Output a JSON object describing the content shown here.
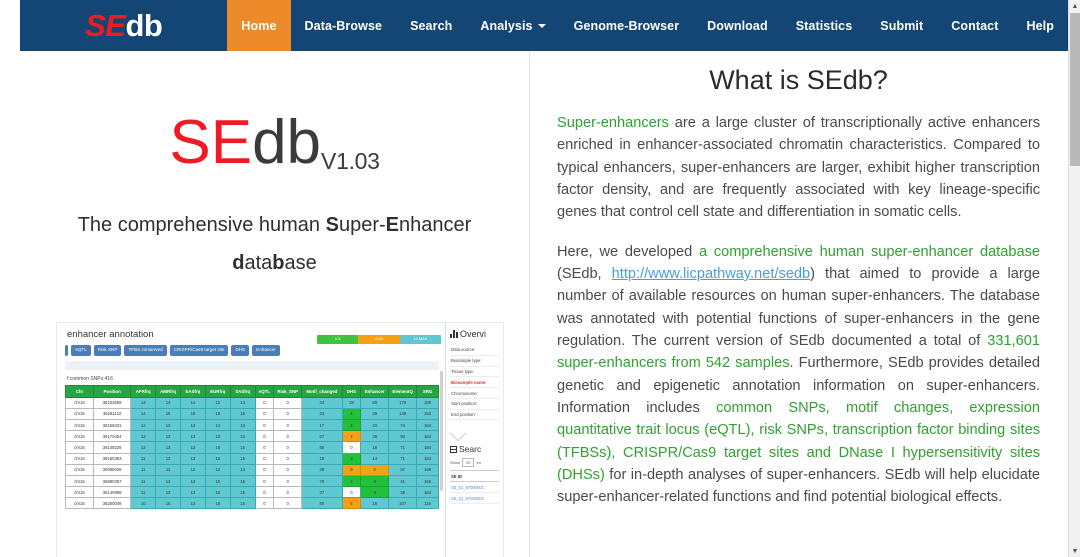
{
  "brand": {
    "part1": "SE",
    "part2": "db"
  },
  "nav": {
    "items": [
      {
        "label": "Home",
        "active": true,
        "caret": false
      },
      {
        "label": "Data-Browse",
        "active": false,
        "caret": false
      },
      {
        "label": "Search",
        "active": false,
        "caret": false
      },
      {
        "label": "Analysis",
        "active": false,
        "caret": true
      },
      {
        "label": "Genome-Browser",
        "active": false,
        "caret": false
      },
      {
        "label": "Download",
        "active": false,
        "caret": false
      },
      {
        "label": "Statistics",
        "active": false,
        "caret": false
      },
      {
        "label": "Submit",
        "active": false,
        "caret": false
      },
      {
        "label": "Contact",
        "active": false,
        "caret": false
      },
      {
        "label": "Help",
        "active": false,
        "caret": false
      }
    ],
    "active_color": "#ED8B2B",
    "background_color": "#134675"
  },
  "hero": {
    "logo_se": "SE",
    "logo_db": "db",
    "version": "V1.03",
    "tagline_line1_a": "The comprehensive human ",
    "tagline_line1_s": "S",
    "tagline_line1_b": "uper-",
    "tagline_line1_e": "E",
    "tagline_line1_c": "nhancer",
    "tagline_line2_d": "d",
    "tagline_line2_a": "ata",
    "tagline_line2_b": "b",
    "tagline_line2_c": "ase"
  },
  "screenshot": {
    "title": "enhancer annotation",
    "buttons": [
      "eQTL",
      "Risk SNP",
      "TFBS conserved",
      "CRISPR/Cas9 target site",
      "DHS",
      "Enhancer"
    ],
    "subtitle": "f common SNPs:416",
    "legend": [
      "0-3",
      "4-10",
      "10-MAX"
    ],
    "table_headers": [
      "Chr",
      "Position",
      "AFRfrq",
      "AMRfrq",
      "EASfrq",
      "EURfrq",
      "SASfrq",
      "eQTL",
      "Risk_SNP",
      "Motif_changed",
      "DHS",
      "Enhancer",
      "ElementQ",
      "SRG"
    ],
    "rows": [
      {
        "chr": "chr16",
        "position": "36233569",
        "afr": "14",
        "amr": "14",
        "eas": "14",
        "eur": "12",
        "sas": "14",
        "eqtl": "0",
        "risk": "0",
        "motif": "24",
        "dhs": "19",
        "enh": "60",
        "elem": "179",
        "srg": "109",
        "dhs_color": "teal",
        "enh_color": "teal"
      },
      {
        "chr": "chr16",
        "position": "36261122",
        "afr": "14",
        "amr": "16",
        "eas": "16",
        "eur": "16",
        "sas": "16",
        "eqtl": "0",
        "risk": "0",
        "motif": "34",
        "dhs": "4",
        "enh": "36",
        "elem": "149",
        "srg": "153",
        "dhs_color": "green",
        "enh_color": "teal"
      },
      {
        "chr": "chr16",
        "position": "36159431",
        "afr": "12",
        "amr": "13",
        "eas": "13",
        "eur": "14",
        "sas": "13",
        "eqtl": "0",
        "risk": "0",
        "motif": "17",
        "dhs": "4",
        "enh": "23",
        "elem": "74",
        "srg": "164",
        "dhs_color": "green",
        "enh_color": "teal"
      },
      {
        "chr": "chr16",
        "position": "36170454",
        "afr": "12",
        "amr": "13",
        "eas": "13",
        "eur": "13",
        "sas": "13",
        "eqtl": "0",
        "risk": "0",
        "motif": "67",
        "dhs": "7",
        "enh": "39",
        "elem": "93",
        "srg": "164",
        "dhs_color": "orange",
        "enh_color": "teal"
      },
      {
        "chr": "chr16",
        "position": "36149229",
        "afr": "12",
        "amr": "13",
        "eas": "13",
        "eur": "15",
        "sas": "15",
        "eqtl": "0",
        "risk": "0",
        "motif": "55",
        "dhs": "0",
        "enh": "18",
        "elem": "71",
        "srg": "164",
        "dhs_color": "white",
        "enh_color": "teal"
      },
      {
        "chr": "chr16",
        "position": "36160363",
        "afr": "11",
        "amr": "13",
        "eas": "13",
        "eur": "15",
        "sas": "15",
        "eqtl": "0",
        "risk": "0",
        "motif": "19",
        "dhs": "3",
        "enh": "14",
        "elem": "71",
        "srg": "164",
        "dhs_color": "green",
        "enh_color": "teal"
      },
      {
        "chr": "chr16",
        "position": "36085036",
        "afr": "11",
        "amr": "11",
        "eas": "12",
        "eur": "14",
        "sas": "14",
        "eqtl": "0",
        "risk": "0",
        "motif": "48",
        "dhs": "9",
        "enh": "6",
        "elem": "57",
        "srg": "169",
        "dhs_color": "orange",
        "enh_color": "orange"
      },
      {
        "chr": "chr16",
        "position": "36890357",
        "afr": "11",
        "amr": "12",
        "eas": "13",
        "eur": "15",
        "sas": "15",
        "eqtl": "0",
        "risk": "0",
        "motif": "70",
        "dhs": "2",
        "enh": "3",
        "elem": "41",
        "srg": "166",
        "dhs_color": "green",
        "enh_color": "green"
      },
      {
        "chr": "chr16",
        "position": "36140999",
        "afr": "11",
        "amr": "13",
        "eas": "13",
        "eur": "15",
        "sas": "15",
        "eqtl": "0",
        "risk": "0",
        "motif": "37",
        "dhs": "0",
        "enh": "4",
        "elem": "38",
        "srg": "164",
        "dhs_color": "white",
        "enh_color": "green"
      },
      {
        "chr": "chr16",
        "position": "36250049",
        "afr": "10",
        "amr": "15",
        "eas": "13",
        "eur": "15",
        "sas": "15",
        "eqtl": "0",
        "risk": "0",
        "motif": "80",
        "dhs": "5",
        "enh": "16",
        "elem": "107",
        "srg": "116",
        "dhs_color": "orange",
        "enh_color": "teal"
      }
    ],
    "overview_title": "Overvi",
    "overview_fields": [
      "Data source:",
      "Biosample type:",
      "Tissue type:",
      "Biosample name:",
      "Chromosome:",
      "Start position:",
      "End position:"
    ],
    "overview_highlight_index": 3,
    "search_title": "Searc",
    "show_label": "Show",
    "show_value": "20",
    "show_suffix": "en",
    "se_id_header": "SE ID",
    "se_ids": [
      "SE_01_87000001",
      "SE_01_87000002"
    ]
  },
  "article": {
    "title": "What is SEdb?",
    "p1": {
      "highlight": "Super-enhancers",
      "rest": " are a large cluster of transcriptionally active enhancers enriched in enhancer-associated chromatin characteristics. Compared to typical enhancers, super-enhancers are larger, exhibit higher transcription factor density, and are frequently associated with key lineage-specific genes that control cell state and differentiation in somatic cells."
    },
    "p2": {
      "s1": "Here, we developed ",
      "g1": "a comprehensive human super-enhancer database",
      "s2": " (SEdb, ",
      "link": "http://www.licpathway.net/sedb",
      "s3": ") that aimed to provide a large number of available resources on human super-enhancers. The database was annotated with potential functions of super-enhancers in the gene regulation. The current version of SEdb documented a total of ",
      "g2": "331,601 super-enhancers from 542 samples",
      "s4": ". Furthermore, SEdb provides detailed genetic and epigenetic annotation information on super-enhancers. Information includes ",
      "g3": "common SNPs, motif changes, expression quantitative trait locus (eQTL), risk SNPs, transcription factor binding sites (TFBSs), CRISPR/Cas9 target sites and DNase I hypersensitivity sites (DHSs)",
      "s5": " for in-depth analyses of super-enhancers. SEdb will help elucidate super-enhancer-related functions and find potential biological effects."
    }
  },
  "scrollbar": {
    "up_arrow": "▲",
    "down_arrow": "▼"
  }
}
